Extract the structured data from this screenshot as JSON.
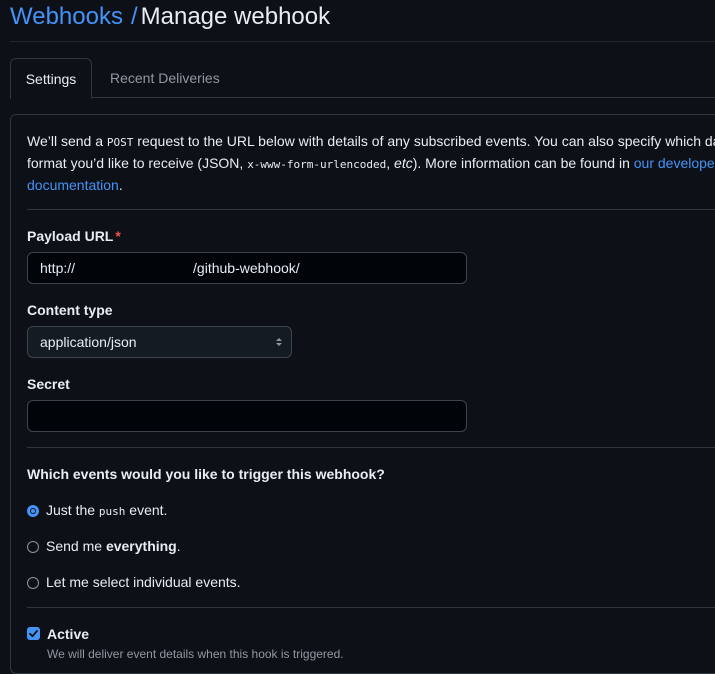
{
  "breadcrumb": {
    "parent": "Webhooks",
    "separator": "/",
    "current": "Manage webhook"
  },
  "tabs": [
    {
      "label": "Settings",
      "selected": true
    },
    {
      "label": "Recent Deliveries",
      "selected": false
    }
  ],
  "intro": {
    "part1": "We’ll send a ",
    "code1": "POST",
    "part2": " request to the URL below with details of any subscribed events. You can also specify which dat",
    "part3": "format you’d like to receive (JSON, ",
    "code2": "x-www-form-urlencoded",
    "part4": ", ",
    "etc": "etc",
    "part5": "). More information can be found in ",
    "link": "our developer",
    "link2": "documentation",
    "end": "."
  },
  "payload_url": {
    "label": "Payload URL",
    "required_mark": "*",
    "prefix": "http://",
    "suffix": "/github-webhook/"
  },
  "content_type": {
    "label": "Content type",
    "selected": "application/json"
  },
  "secret": {
    "label": "Secret",
    "value": ""
  },
  "events": {
    "question": "Which events would you like to trigger this webhook?",
    "options": [
      {
        "pre": "Just the ",
        "code": "push",
        "post": " event.",
        "checked": true
      },
      {
        "pre": "Send me ",
        "bold": "everything",
        "post": ".",
        "checked": false
      },
      {
        "pre": "Let me select individual events.",
        "checked": false
      }
    ]
  },
  "active": {
    "label": "Active",
    "checked": true,
    "note": "We will deliver event details when this hook is triggered."
  },
  "colors": {
    "background": "#0d1117",
    "link": "#4493f8",
    "border": "#30363d",
    "required": "#f85149"
  }
}
